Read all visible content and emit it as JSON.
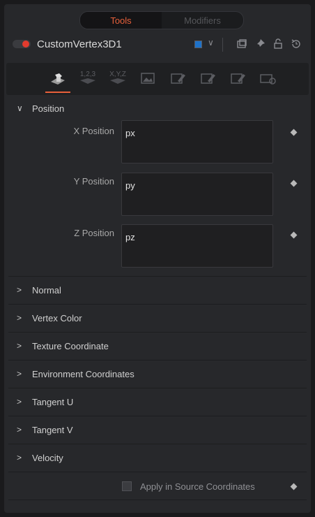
{
  "tabs": [
    {
      "label": "Tools",
      "active": true
    },
    {
      "label": "Modifiers",
      "active": false
    }
  ],
  "tool": {
    "name": "CustomVertex3D1",
    "enabled": true,
    "color_swatch": "#1e72c9",
    "header_icons": [
      "clipboard-icon",
      "pin-icon",
      "lock-icon",
      "reset-icon"
    ]
  },
  "toolbar_icons": [
    {
      "name": "controls-tab-icon",
      "label": "",
      "active": true
    },
    {
      "name": "numbers-tab-icon",
      "label": "1,2,3",
      "active": false
    },
    {
      "name": "xyz-tab-icon",
      "label": "X,Y,Z",
      "active": false
    },
    {
      "name": "image-tab-icon",
      "label": "",
      "active": false
    },
    {
      "name": "edit-tab-icon-1",
      "label": "",
      "active": false
    },
    {
      "name": "edit-tab-icon-2",
      "label": "",
      "active": false
    },
    {
      "name": "edit-tab-icon-3",
      "label": "",
      "active": false
    },
    {
      "name": "settings-tab-icon",
      "label": "",
      "active": false
    }
  ],
  "position": {
    "label": "Position",
    "fields": [
      {
        "label": "X Position",
        "value": "px"
      },
      {
        "label": "Y Position",
        "value": "py"
      },
      {
        "label": "Z Position",
        "value": "pz"
      }
    ]
  },
  "sections": [
    "Normal",
    "Vertex Color",
    "Texture Coordinate",
    "Environment Coordinates",
    "Tangent U",
    "Tangent V",
    "Velocity"
  ],
  "apply_source": {
    "label": "Apply in Source Coordinates",
    "checked": false
  },
  "colors": {
    "accent": "#e8603a",
    "toggle_on": "#e23b2e"
  }
}
